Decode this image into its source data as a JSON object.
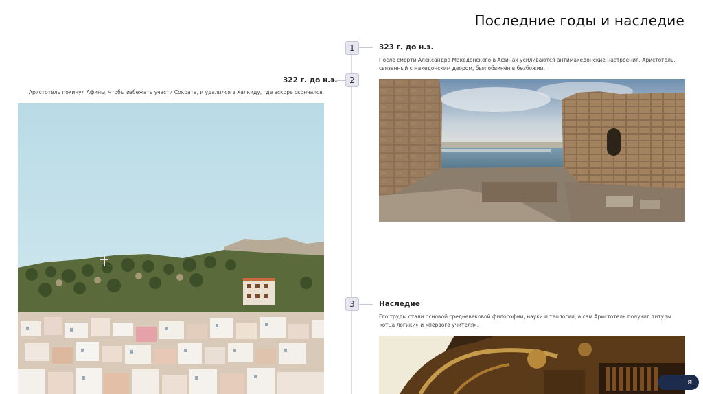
{
  "slide": {
    "title": "Последние годы и наследие"
  },
  "timeline": [
    {
      "number": "1",
      "title": "323 г. до н.э.",
      "text": "После смерти Александра Македонского в Афинах усиливаются антимакедонские настроения. Аристотель, связанный с македонским двором, был обвинён в безбожии."
    },
    {
      "number": "2",
      "title": "322 г. до н.э.",
      "text": "Аристотель покинул Афины, чтобы избежать участи Сократа, и удалился в Халкиду, где вскоре скончался."
    },
    {
      "number": "3",
      "title": "Наследие",
      "text": "Его труды стали основой средневековой философии, науки и теологии, а сам Аристотель получил титулы «отца логики» и «первого учителя»."
    }
  ],
  "badge": {
    "label": "я"
  },
  "colors": {
    "marker_bg": "#e6e6f3",
    "timeline_line": "#d9d9de",
    "badge_bg": "#1d2b4d"
  }
}
